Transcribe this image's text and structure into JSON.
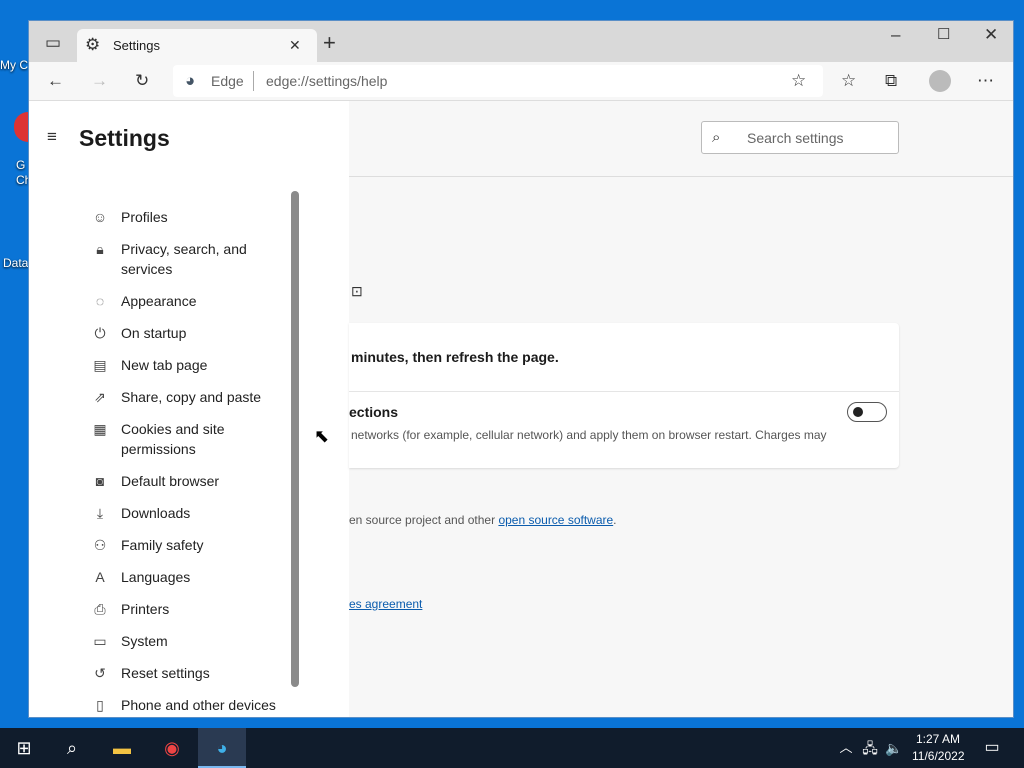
{
  "desktop": {
    "icons": [
      "My C",
      "G\nCh",
      "Data"
    ]
  },
  "browser": {
    "tab_title": "Settings",
    "address_prefix": "Edge",
    "url": "edge://settings/help",
    "window_controls": [
      "minimize",
      "maximize",
      "close"
    ]
  },
  "sidebar": {
    "title": "Settings",
    "items": [
      {
        "label": "Profiles",
        "icon": "profile-icon"
      },
      {
        "label": "Privacy, search, and services",
        "icon": "lock-icon"
      },
      {
        "label": "Appearance",
        "icon": "palette-icon"
      },
      {
        "label": "On startup",
        "icon": "power-icon"
      },
      {
        "label": "New tab page",
        "icon": "new-tab-icon"
      },
      {
        "label": "Share, copy and paste",
        "icon": "share-icon"
      },
      {
        "label": "Cookies and site permissions",
        "icon": "cookies-icon"
      },
      {
        "label": "Default browser",
        "icon": "default-browser-icon"
      },
      {
        "label": "Downloads",
        "icon": "download-icon"
      },
      {
        "label": "Family safety",
        "icon": "family-icon"
      },
      {
        "label": "Languages",
        "icon": "languages-icon"
      },
      {
        "label": "Printers",
        "icon": "printer-icon"
      },
      {
        "label": "System",
        "icon": "system-icon"
      },
      {
        "label": "Reset settings",
        "icon": "reset-icon"
      },
      {
        "label": "Phone and other devices",
        "icon": "phone-icon"
      }
    ]
  },
  "content": {
    "search_placeholder": "Search settings",
    "message": "minutes, then refresh the page.",
    "metered_title": "ections",
    "metered_desc": "networks (for example, cellular network) and apply them on browser restart. Charges may",
    "metered_toggle_on": false,
    "oss_text": "en source project and other ",
    "oss_link": "open source software",
    "oss_end": ".",
    "agreement_link": "es agreement"
  },
  "taskbar": {
    "time": "1:27 AM",
    "date": "11/6/2022"
  }
}
